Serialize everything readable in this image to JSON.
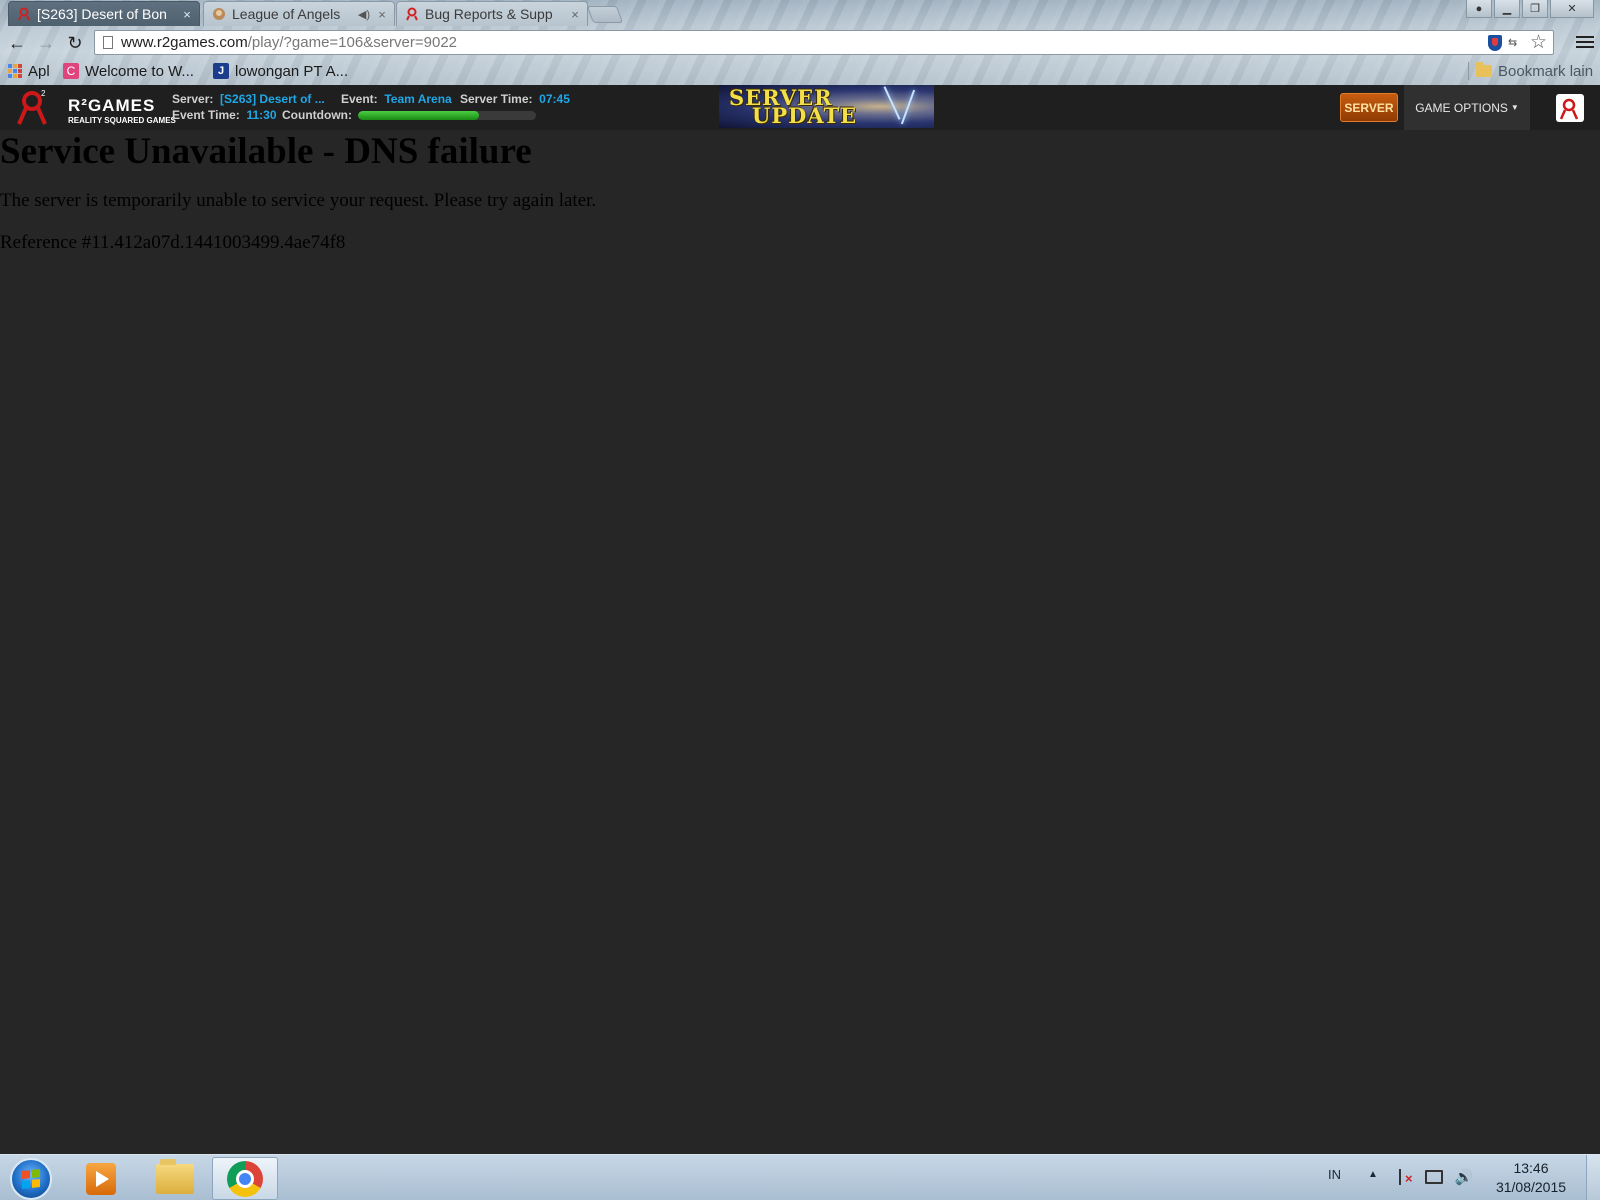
{
  "browser": {
    "tabs": [
      {
        "label": "[S263] Desert of Bon",
        "active": true
      },
      {
        "label": "League of Angels",
        "active": false,
        "audio": true
      },
      {
        "label": "Bug Reports & Supp",
        "active": false
      }
    ],
    "address": {
      "host": "www.r2games.com",
      "path": "/play/?game=106&server=9022"
    },
    "bookmarks": [
      {
        "label": "Apl",
        "icon": "apps-grid-icon"
      },
      {
        "label": "Welcome to W...",
        "icon": "letter-c-icon",
        "glyph": "C"
      },
      {
        "label": "lowongan PT A...",
        "icon": "letter-j-icon",
        "glyph": "J"
      }
    ],
    "other_bookmarks": "Bookmark lain"
  },
  "site_header": {
    "logo": {
      "word": "R²GAMES",
      "tagline": "REALITY SQUARED GAMES"
    },
    "server_label": "Server:",
    "server_value": "[S263] Desert of ...",
    "event_label": "Event:",
    "event_value": "Team Arena",
    "server_time_label": "Server Time:",
    "server_time_value": "07:45",
    "event_time_label": "Event Time:",
    "event_time_value": "11:30",
    "countdown_label": "Countdown:",
    "countdown_progress": 0.68,
    "banner_line1": "SERVER",
    "banner_line2": "UPDATE",
    "server_button": "SERVER",
    "game_options": "GAME OPTIONS",
    "colors": {
      "accent_blue": "#1fa7e6",
      "server_button": "#c75d10",
      "countdown_green": "#2fb52a"
    }
  },
  "error": {
    "title": "Service Unavailable - DNS failure",
    "message": "The server is temporarily unable to service your request. Please try again later.",
    "reference": "Reference #11.412a07d.1441003499.4ae74f8"
  },
  "taskbar": {
    "language": "IN",
    "time": "13:46",
    "date": "31/08/2015"
  }
}
